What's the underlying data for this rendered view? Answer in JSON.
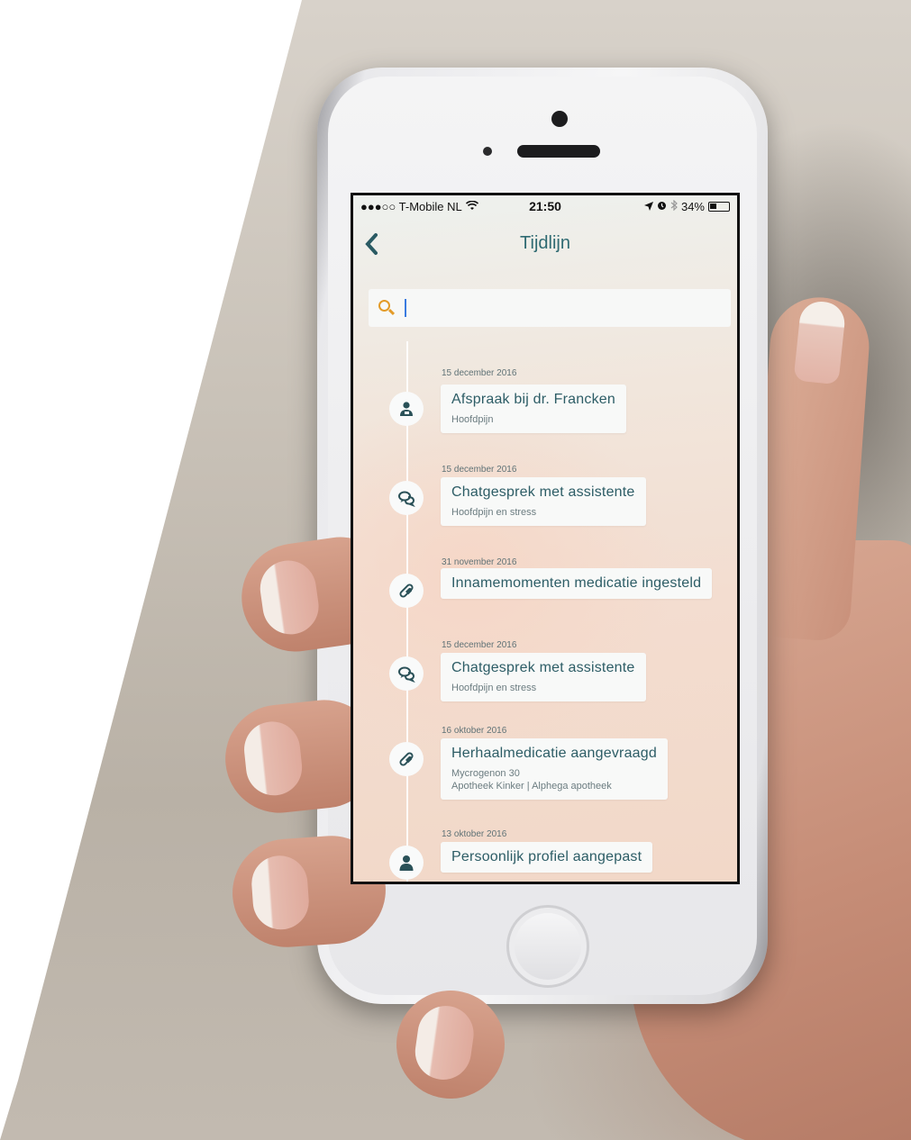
{
  "status_bar": {
    "carrier": "●●●○○ T-Mobile NL",
    "wifi": "wifi-icon",
    "time": "21:50",
    "battery_text": "34%"
  },
  "nav": {
    "title": "Tijdlijn",
    "back_icon": "chevron-left-icon"
  },
  "search": {
    "placeholder": "",
    "value": ""
  },
  "colors": {
    "accent": "#2f6a72",
    "search_icon": "#e39b28"
  },
  "timeline": [
    {
      "date": "15 december 2016",
      "icon": "doctor-icon",
      "title": "Afspraak bij dr. Francken",
      "lines": [
        "Hoofdpijn"
      ]
    },
    {
      "date": "15 december 2016",
      "icon": "chat-icon",
      "title": "Chatgesprek met assistente",
      "lines": [
        "Hoofdpijn en stress"
      ]
    },
    {
      "date": "31 november 2016",
      "icon": "pill-icon",
      "title": "Innamemomenten medicatie ingesteld",
      "lines": []
    },
    {
      "date": "15 december 2016",
      "icon": "chat-icon",
      "title": "Chatgesprek met assistente",
      "lines": [
        "Hoofdpijn en stress"
      ]
    },
    {
      "date": "16 oktober 2016",
      "icon": "pill-icon",
      "title": "Herhaalmedicatie aangevraagd",
      "lines": [
        "Mycrogenon 30",
        "Apotheek Kinker | Alphega apotheek"
      ]
    },
    {
      "date": "13 oktober 2016",
      "icon": "person-icon",
      "title": "Persoonlijk profiel aangepast",
      "lines": []
    }
  ]
}
